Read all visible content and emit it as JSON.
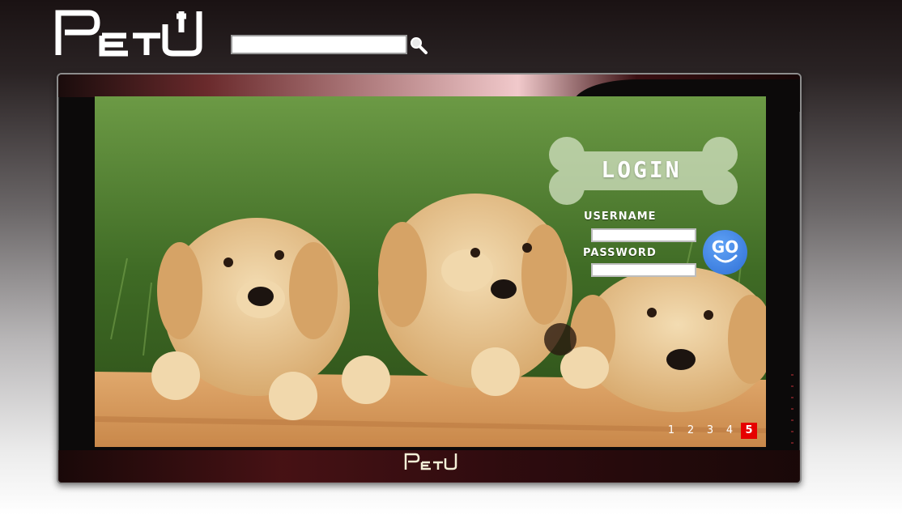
{
  "header": {
    "logo_text": "PetU",
    "search": {
      "value": "",
      "placeholder": ""
    }
  },
  "login": {
    "title": "LOGIN",
    "username_label": "USERNAME",
    "password_label": "PASSWORD",
    "username_value": "",
    "password_value": "",
    "go_label": "GO"
  },
  "slideshow": {
    "pages": [
      "1",
      "2",
      "3",
      "4",
      "5"
    ],
    "active_page": "5"
  },
  "footer": {
    "monitor_logo_text": "PetU"
  },
  "colors": {
    "accent": "#e60000",
    "go_button": "#3a7be0",
    "monitor_bezel": "#0c0a0a"
  },
  "icons": {
    "search": "magnifier-icon",
    "go": "smiley-go-icon"
  }
}
